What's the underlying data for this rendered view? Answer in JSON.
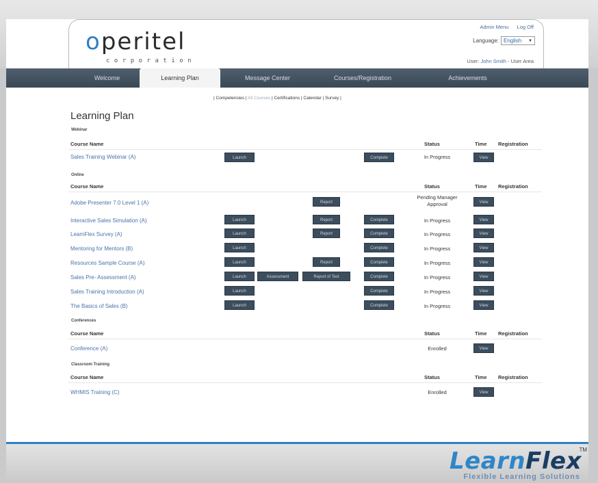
{
  "header": {
    "logo_main": "peritel",
    "logo_letter": "o",
    "logo_sub": "corporation",
    "admin_menu": "Admin Menu",
    "log_off": "Log Off",
    "language_label": "Language:",
    "language_value": "English",
    "user_label": "User:",
    "user_name": "John Smith",
    "user_area": "- User Area"
  },
  "nav": {
    "tabs": [
      {
        "label": "Welcome"
      },
      {
        "label": "Learning Plan"
      },
      {
        "label": "Message Center"
      },
      {
        "label": "Courses/Registration"
      },
      {
        "label": "Achievements"
      }
    ]
  },
  "subnav": {
    "prefix": "| Competencies |",
    "all_courses": " All Courses ",
    "rest": "| Certifications | Calendar | Survey |"
  },
  "page": {
    "title": "Learning Plan"
  },
  "headers": {
    "course_name": "Course Name",
    "status": "Status",
    "time": "Time",
    "registration": "Registration"
  },
  "buttons": {
    "launch": "Launch",
    "complete": "Complete",
    "report": "Report",
    "assessment": "Assessment",
    "report_of_test": "Report of Test",
    "view": "View"
  },
  "sections": {
    "webinar": {
      "label": "Webinar",
      "rows": [
        {
          "course": "Sales Training Webinar  (A)",
          "status": "In Progress"
        }
      ]
    },
    "online": {
      "label": "Online",
      "rows": [
        {
          "course": "Adobe Presenter 7.0 Level 1  (A)",
          "status": "Pending Manager Approval"
        },
        {
          "course": "Interactive Sales Simulation  (A)",
          "status": "In Progress"
        },
        {
          "course": "LearnFlex Survey  (A)",
          "status": "In Progress"
        },
        {
          "course": "Mentoring for Mentors  (B)",
          "status": "In Progress"
        },
        {
          "course": "Resources Sample Course  (A)",
          "status": "In Progress"
        },
        {
          "course": "Sales Pre- Assessment  (A)",
          "status": "In Progress"
        },
        {
          "course": "Sales Training Introduction  (A)",
          "status": "In Progress"
        },
        {
          "course": "The Basics of Sales  (B)",
          "status": "In Progress"
        }
      ]
    },
    "conferences": {
      "label": "Conferences",
      "rows": [
        {
          "course": "Conference  (A)",
          "status": "Enrolled"
        }
      ]
    },
    "classroom": {
      "label": "Classroom Training",
      "rows": [
        {
          "course": "WHMIS Training  (C)",
          "status": "Enrolled"
        }
      ]
    }
  },
  "footer": {
    "brand_learn": "Learn",
    "brand_flex": "Flex",
    "tm": "TM",
    "tagline": "Flexible Learning Solutions"
  },
  "colors": {
    "accent": "#2f7fc4",
    "nav_bg": "#3a4855",
    "button_bg": "#3c4d5d",
    "link": "#4a73a8"
  }
}
